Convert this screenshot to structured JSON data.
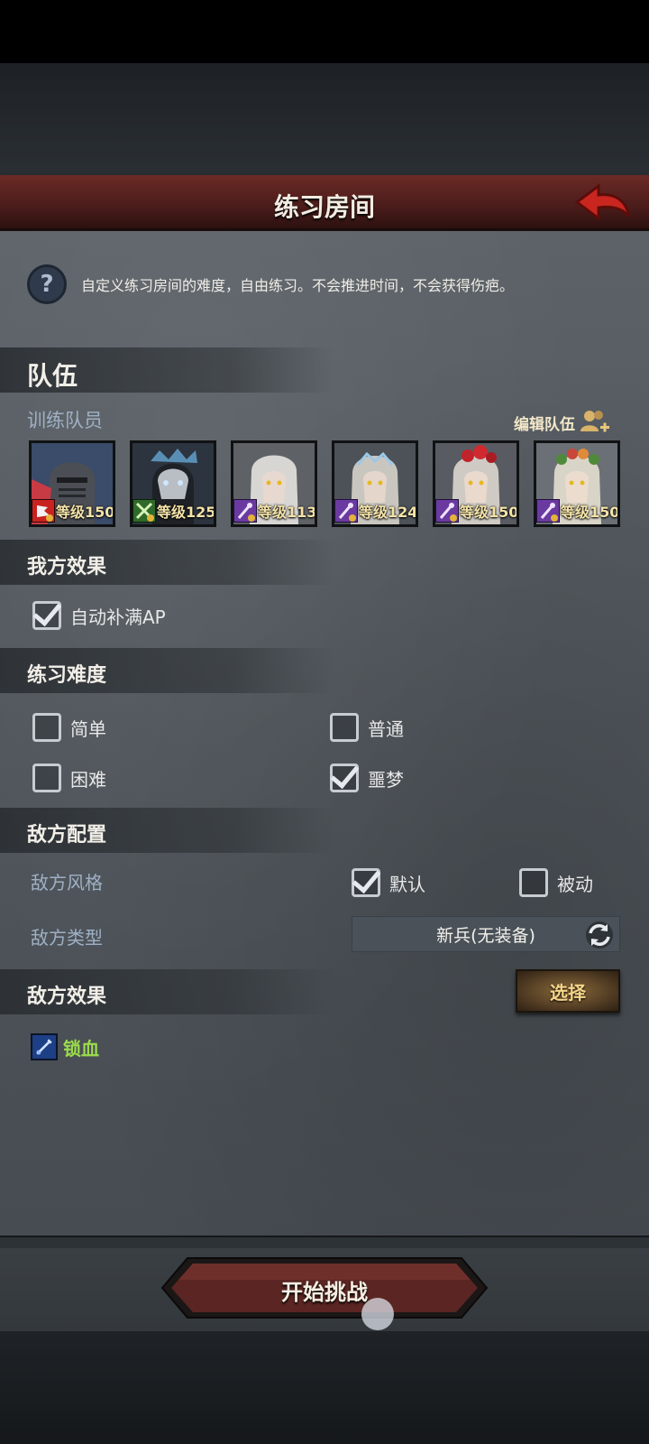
{
  "header": {
    "title": "练习房间"
  },
  "info": {
    "text": "自定义练习房间的难度，自由练习。不会推进时间，不会获得伤疤。"
  },
  "team": {
    "section_title": "队伍",
    "members_label": "训练队员",
    "edit_label": "编辑队伍",
    "heroes": [
      {
        "level": "等级150",
        "class_icon": "flag-crest-icon",
        "portrait": "armored-knight"
      },
      {
        "level": "等级125",
        "class_icon": "crossed-swords-icon",
        "portrait": "masked-elf"
      },
      {
        "level": "等级113",
        "class_icon": "staff-icon",
        "portrait": "elf-mage"
      },
      {
        "level": "等级124",
        "class_icon": "staff-icon",
        "portrait": "elf-tiara"
      },
      {
        "level": "等级150",
        "class_icon": "staff-icon",
        "portrait": "elf-red-flower"
      },
      {
        "level": "等级150",
        "class_icon": "staff-icon",
        "portrait": "elf-flower-crown"
      }
    ]
  },
  "our_effects": {
    "title": "我方效果",
    "auto_ap": {
      "label": "自动补满AP",
      "checked": true
    }
  },
  "difficulty": {
    "title": "练习难度",
    "options": [
      {
        "label": "简单",
        "checked": false
      },
      {
        "label": "普通",
        "checked": false
      },
      {
        "label": "困难",
        "checked": false
      },
      {
        "label": "噩梦",
        "checked": true
      }
    ]
  },
  "enemy_config": {
    "title": "敌方配置",
    "style_label": "敌方风格",
    "style_options": [
      {
        "label": "默认",
        "checked": true
      },
      {
        "label": "被动",
        "checked": false
      }
    ],
    "type_label": "敌方类型",
    "type_value": "新兵(无装备)"
  },
  "enemy_effects": {
    "title": "敌方效果",
    "select_label": "选择",
    "effect_label": "锁血",
    "effect_icon": "sword-icon"
  },
  "footer": {
    "start_label": "开始挑战"
  },
  "colors": {
    "title_bar": "#4a1c1a",
    "accent_gold": "#f7d68a",
    "effect_green": "#9cdb4c",
    "back_arrow": "#c9261f"
  }
}
